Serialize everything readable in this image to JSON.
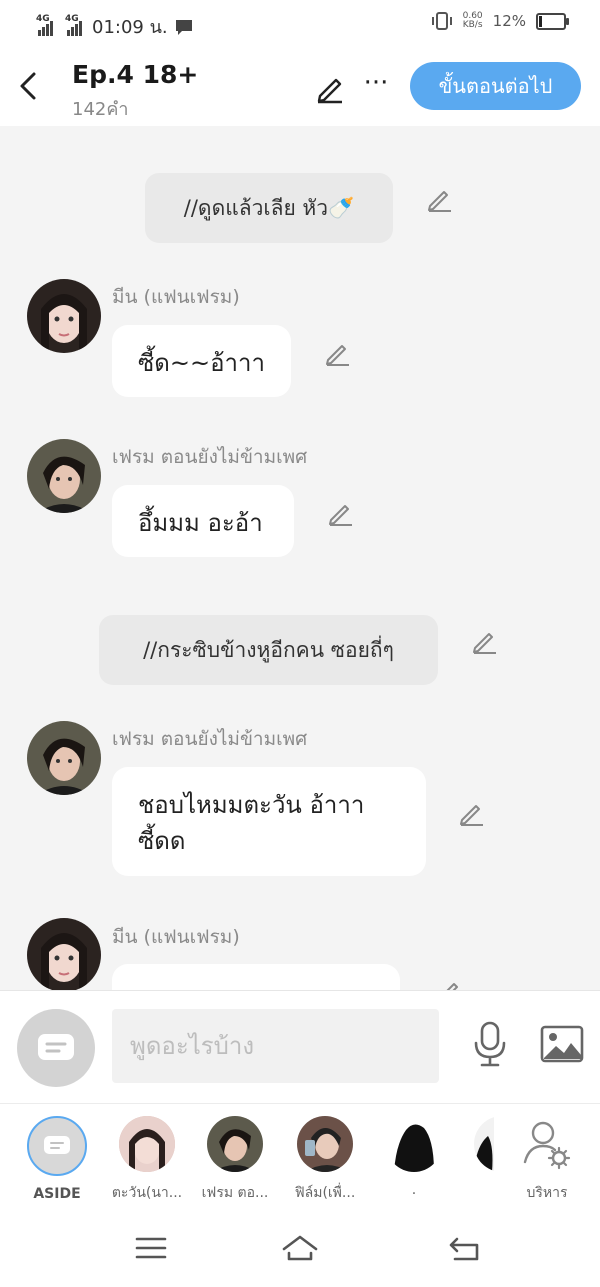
{
  "status": {
    "net1": "4G",
    "net2": "4G",
    "time": "01:09 น.",
    "speed_value": "0.60",
    "speed_unit": "KB/s",
    "battery": "12%",
    "battery_level": 0.12
  },
  "header": {
    "title": "Ep.4 18+",
    "word_count": "142คำ",
    "more_label": "···",
    "next_label": "ขั้นตอนต่อไป"
  },
  "messages": [
    {
      "type": "narration",
      "text": "//ดูดแล้วเลีย หัว🍼"
    },
    {
      "type": "chat",
      "sender": "มีน (แฟนเฟรม)",
      "text": "ซี้ด~~อ้าาา"
    },
    {
      "type": "chat",
      "sender": "เฟรม ตอนยังไม่ข้ามเพศ",
      "text": "อึ้มมม อะอ้า"
    },
    {
      "type": "narration",
      "text": "//กระซิบข้างหูอีกคน ซอยถี่ๆ"
    },
    {
      "type": "chat",
      "sender": "เฟรม ตอนยังไม่ข้ามเพศ",
      "text": "ชอบไหมมตะวัน อ้าาา ซี้ดด"
    },
    {
      "type": "chat",
      "sender": "มีน (แฟนเฟรม)",
      "text": ""
    }
  ],
  "input": {
    "placeholder": "พูดอะไรบ้าง"
  },
  "characters": [
    {
      "label": "ASIDE"
    },
    {
      "label": "ตะวัน(นา..."
    },
    {
      "label": "เฟรม ตอ..."
    },
    {
      "label": "ฟิล์ม(เพื่..."
    },
    {
      "label": "."
    },
    {
      "label": ""
    },
    {
      "label": "บริหาร"
    }
  ],
  "colors": {
    "accent": "#5aa9f0",
    "chat_bg": "#f4f4f4",
    "narration_bg": "#e9e9e9",
    "bubble_bg": "#ffffff"
  },
  "icons": {
    "back": "chevron-left-icon",
    "edit": "pencil-icon",
    "more": "more-dots-icon",
    "aside": "chat-bubble-icon",
    "mic": "microphone-icon",
    "image": "image-icon",
    "manage": "user-gear-icon",
    "nav_menu": "menu-icon",
    "nav_home": "home-icon",
    "nav_back": "back-arrow-icon"
  }
}
